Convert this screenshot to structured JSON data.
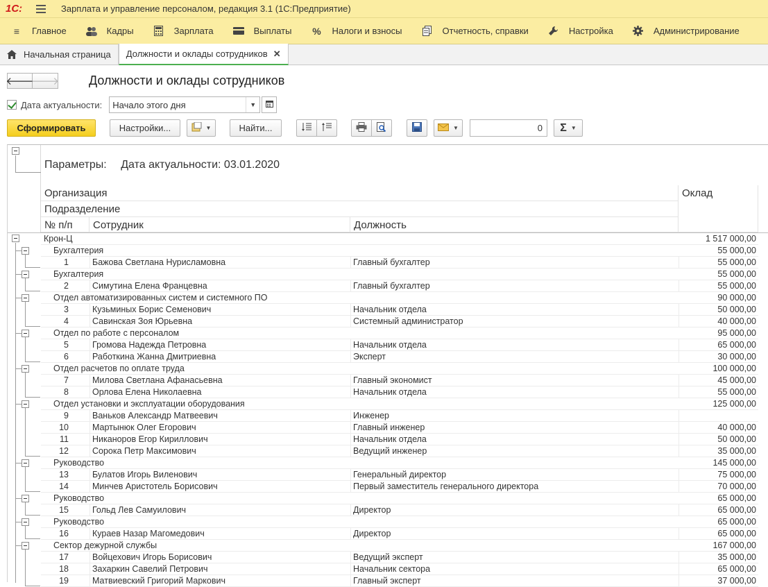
{
  "app": {
    "logo": "1С:",
    "title": "Зарплата и управление персоналом, редакция 3.1  (1С:Предприятие)"
  },
  "menu": [
    {
      "label": "Главное",
      "icon": "menu-icon"
    },
    {
      "label": "Кадры",
      "icon": "people-icon"
    },
    {
      "label": "Зарплата",
      "icon": "calculator-icon"
    },
    {
      "label": "Выплаты",
      "icon": "wallet-icon"
    },
    {
      "label": "Налоги и взносы",
      "icon": "percent-icon"
    },
    {
      "label": "Отчетность, справки",
      "icon": "documents-icon"
    },
    {
      "label": "Настройка",
      "icon": "wrench-icon"
    },
    {
      "label": "Администрирование",
      "icon": "gear-icon"
    }
  ],
  "tabs": {
    "home": "Начальная страница",
    "active": "Должности и оклады сотрудников"
  },
  "form": {
    "title": "Должности и оклады сотрудников",
    "date_label": "Дата актуальности:",
    "date_value": "Начало этого дня",
    "generate": "Сформировать",
    "settings": "Настройки...",
    "find": "Найти...",
    "sum_value": "0"
  },
  "report": {
    "params_label": "Параметры:",
    "params_value": "Дата актуальности: 03.01.2020",
    "headers": {
      "org": "Организация",
      "dept": "Подразделение",
      "num": "№ п/п",
      "employee": "Сотрудник",
      "position": "Должность",
      "salary": "Оклад"
    },
    "org": {
      "name": "Крон-Ц",
      "amount": "1 517 000,00"
    },
    "rows": [
      {
        "kind": "group",
        "name": "Бухгалтерия",
        "amount": "55 000,00"
      },
      {
        "kind": "item",
        "num": "1",
        "name": "Бажова Светлана Нурисламовна",
        "position": "Главный бухгалтер",
        "amount": "55 000,00"
      },
      {
        "kind": "group",
        "name": "Бухгалтерия",
        "amount": "55 000,00"
      },
      {
        "kind": "item",
        "num": "2",
        "name": "Симутина Елена Францевна",
        "position": "Главный бухгалтер",
        "amount": "55 000,00"
      },
      {
        "kind": "group",
        "name": "Отдел автоматизированных систем и системного ПО",
        "amount": "90 000,00"
      },
      {
        "kind": "item",
        "num": "3",
        "name": "Кузьминых Борис Семенович",
        "position": "Начальник отдела",
        "amount": "50 000,00"
      },
      {
        "kind": "item",
        "num": "4",
        "name": "Савинская Зоя Юрьевна",
        "position": "Системный администратор",
        "amount": "40 000,00"
      },
      {
        "kind": "group",
        "name": "Отдел по работе с персоналом",
        "amount": "95 000,00"
      },
      {
        "kind": "item",
        "num": "5",
        "name": "Громова Надежда Петровна",
        "position": "Начальник отдела",
        "amount": "65 000,00"
      },
      {
        "kind": "item",
        "num": "6",
        "name": "Работкина Жанна Дмитриевна",
        "position": "Эксперт",
        "amount": "30 000,00"
      },
      {
        "kind": "group",
        "name": "Отдел расчетов по оплате труда",
        "amount": "100 000,00"
      },
      {
        "kind": "item",
        "num": "7",
        "name": "Милова Светлана Афанасьевна",
        "position": "Главный экономист",
        "amount": "45 000,00"
      },
      {
        "kind": "item",
        "num": "8",
        "name": "Орлова Елена Николаевна",
        "position": "Начальник отдела",
        "amount": "55 000,00"
      },
      {
        "kind": "group",
        "name": "Отдел установки и эксплуатации оборудования",
        "amount": "125 000,00"
      },
      {
        "kind": "item",
        "num": "9",
        "name": "Ваньков Александр Матвеевич",
        "position": "Инженер",
        "amount": ""
      },
      {
        "kind": "item",
        "num": "10",
        "name": "Мартынюк Олег Егорович",
        "position": "Главный инженер",
        "amount": "40 000,00"
      },
      {
        "kind": "item",
        "num": "11",
        "name": "Никаноров Егор Кириллович",
        "position": "Начальник отдела",
        "amount": "50 000,00"
      },
      {
        "kind": "item",
        "num": "12",
        "name": "Сорока Петр Максимович",
        "position": "Ведущий инженер",
        "amount": "35 000,00"
      },
      {
        "kind": "group",
        "name": "Руководство",
        "amount": "145 000,00"
      },
      {
        "kind": "item",
        "num": "13",
        "name": "Булатов Игорь Виленович",
        "position": "Генеральный директор",
        "amount": "75 000,00"
      },
      {
        "kind": "item",
        "num": "14",
        "name": "Минчев Аристотель Борисович",
        "position": "Первый заместитель генерального директора",
        "amount": "70 000,00"
      },
      {
        "kind": "group",
        "name": "Руководство",
        "amount": "65 000,00"
      },
      {
        "kind": "item",
        "num": "15",
        "name": "Гольд Лев Самуилович",
        "position": "Директор",
        "amount": "65 000,00"
      },
      {
        "kind": "group",
        "name": "Руководство",
        "amount": "65 000,00"
      },
      {
        "kind": "item",
        "num": "16",
        "name": "Кураев Назар Магомедович",
        "position": "Директор",
        "amount": "65 000,00"
      },
      {
        "kind": "group",
        "name": "Сектор дежурной службы",
        "amount": "167 000,00"
      },
      {
        "kind": "item",
        "num": "17",
        "name": "Войцехович Игорь Борисович",
        "position": "Ведущий эксперт",
        "amount": "35 000,00"
      },
      {
        "kind": "item",
        "num": "18",
        "name": "Захаркин Савелий Петрович",
        "position": "Начальник сектора",
        "amount": "65 000,00"
      },
      {
        "kind": "item",
        "num": "19",
        "name": "Матвиевский Григорий Маркович",
        "position": "Главный эксперт",
        "amount": "37 000,00"
      }
    ]
  }
}
